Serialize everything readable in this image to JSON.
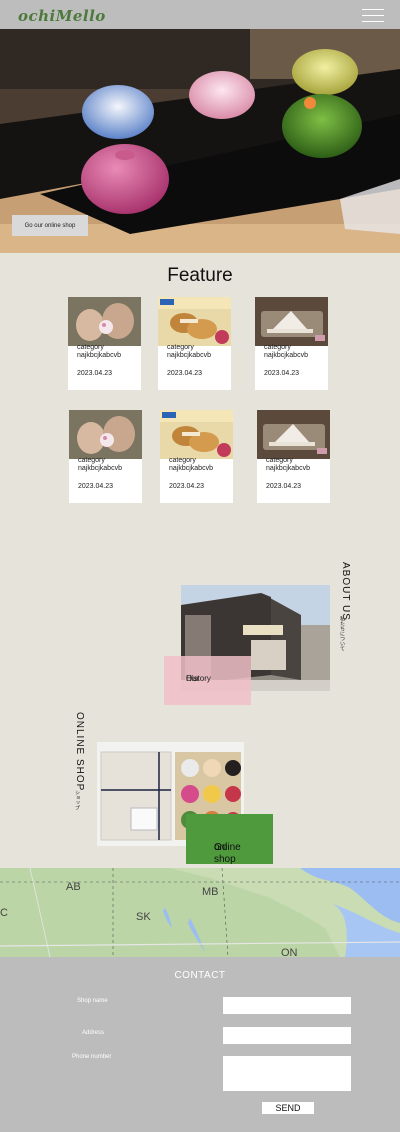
{
  "header": {
    "logo_text": "ochiMello",
    "menu_icon": "hamburger-menu-icon"
  },
  "hero": {
    "shop_button_label": "Go our online shop"
  },
  "feature": {
    "title": "Feature",
    "cards": [
      {
        "category": "category",
        "name": "najkbcjkabcvb",
        "date": "2023.04.23"
      },
      {
        "category": "category",
        "name": "najkbcjkabcvb",
        "date": "2023.04.23"
      },
      {
        "category": "category",
        "name": "najkbcjkabcvb",
        "date": "2023.04.23"
      },
      {
        "category": "category",
        "name": "najkbcjkabcvb",
        "date": "2023.04.23"
      },
      {
        "category": "category",
        "name": "najkbcjkabcvb",
        "date": "2023.04.23"
      },
      {
        "category": "category",
        "name": "najkbcjkabcvb",
        "date": "2023.04.23"
      }
    ]
  },
  "about": {
    "title": "ABOUT US",
    "subtitle": "私たちについて",
    "history_label_1": "Our",
    "history_label_2": "History"
  },
  "online_shop": {
    "title": "ONLINE SHOP",
    "subtitle": "ショップ",
    "go_label_1": "Go",
    "go_label_2": "online shop"
  },
  "map": {
    "labels": [
      "AB",
      "MB",
      "SK",
      "ON",
      "C"
    ]
  },
  "contact": {
    "title": "CONTACT",
    "shop_name_label": "Shop name",
    "address_label": "Address",
    "phone_label": "Phone number",
    "send_label": "SEND"
  },
  "colors": {
    "accent_green": "#4e9a3c",
    "history_pink": "#f0bec8",
    "background": "#e6e3da",
    "contact_bg": "#bcbcbc"
  }
}
